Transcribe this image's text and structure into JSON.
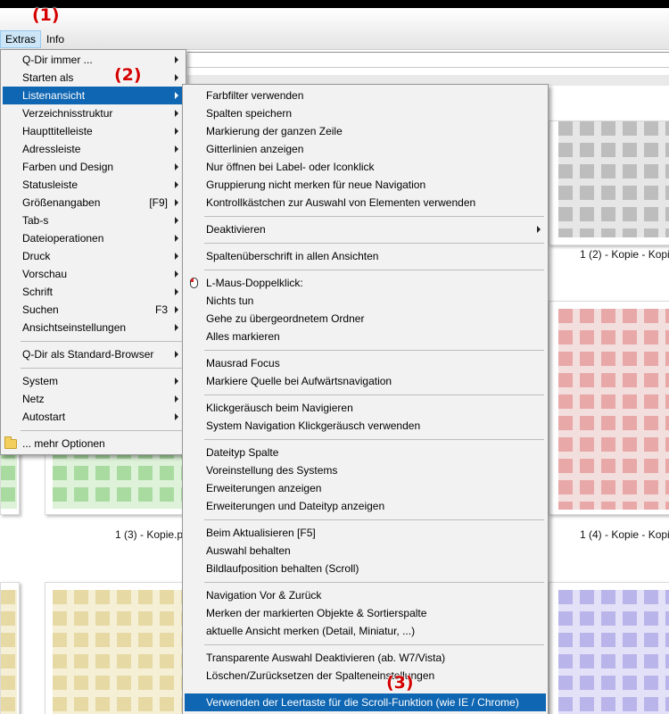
{
  "menubar": {
    "items": [
      "Extras",
      "Info"
    ]
  },
  "annotations": [
    "(1)",
    "(2)",
    "(3)"
  ],
  "file_labels": [
    "1 (2) - Kopie - Kopi",
    "1 (3) - Kopie.p",
    "1 (4) - Kopie - Kopi"
  ],
  "extras_menu": {
    "items": [
      {
        "label": "Q-Dir immer ...",
        "submenu": true
      },
      {
        "label": "Starten als",
        "submenu": true
      },
      {
        "label": "Listenansicht",
        "submenu": true,
        "selected": true
      },
      {
        "label": "Verzeichnisstruktur",
        "submenu": true
      },
      {
        "label": "Haupttitelleiste",
        "submenu": true
      },
      {
        "label": "Adressleiste",
        "submenu": true
      },
      {
        "label": "Farben und Design",
        "submenu": true
      },
      {
        "label": "Statusleiste",
        "submenu": true
      },
      {
        "label": "Größenangaben",
        "shortcut": "[F9]",
        "submenu": true
      },
      {
        "label": "Tab-s",
        "submenu": true
      },
      {
        "label": "Dateioperationen",
        "submenu": true
      },
      {
        "label": "Druck",
        "submenu": true
      },
      {
        "label": "Vorschau",
        "submenu": true
      },
      {
        "label": "Schrift",
        "submenu": true
      },
      {
        "label": "Suchen",
        "shortcut": "F3",
        "submenu": true
      },
      {
        "label": "Ansichtseinstellungen",
        "submenu": true
      },
      {
        "label": "Q-Dir als Standard-Browser",
        "submenu": true
      },
      {
        "label": "System",
        "submenu": true
      },
      {
        "label": "Netz",
        "submenu": true
      },
      {
        "label": "Autostart",
        "submenu": true
      },
      {
        "label": "... mehr Optionen",
        "icon": "folder-icon"
      }
    ]
  },
  "listenansicht_menu": {
    "items": [
      {
        "label": "Farbfilter verwenden"
      },
      {
        "label": "Spalten speichern"
      },
      {
        "label": "Markierung der ganzen Zeile"
      },
      {
        "label": "Gitterlinien anzeigen"
      },
      {
        "label": "Nur öffnen bei Label- oder Iconklick"
      },
      {
        "label": "Gruppierung nicht merken für neue Navigation"
      },
      {
        "label": "Kontrollkästchen zur Auswahl von Elementen verwenden"
      },
      {
        "label": "Deaktivieren",
        "submenu": true
      },
      {
        "label": "Spaltenüberschrift in allen Ansichten"
      },
      {
        "label": "L-Maus-Doppelklick:",
        "icon": "mouse-icon"
      },
      {
        "label": "Nichts tun"
      },
      {
        "label": "Gehe zu übergeordnetem Ordner"
      },
      {
        "label": "Alles markieren"
      },
      {
        "label": "Mausrad Focus"
      },
      {
        "label": "Markiere Quelle bei Aufwärtsnavigation"
      },
      {
        "label": "Klickgeräusch beim Navigieren"
      },
      {
        "label": "System Navigation Klickgeräusch verwenden"
      },
      {
        "label": "Dateityp Spalte"
      },
      {
        "label": "Voreinstellung des Systems"
      },
      {
        "label": "Erweiterungen anzeigen"
      },
      {
        "label": "Erweiterungen und Dateityp anzeigen"
      },
      {
        "label": "Beim Aktualisieren [F5]"
      },
      {
        "label": "Auswahl behalten"
      },
      {
        "label": "Bildlaufposition behalten (Scroll)"
      },
      {
        "label": "Navigation Vor & Zurück"
      },
      {
        "label": "Merken der markierten Objekte & Sortierspalte"
      },
      {
        "label": "aktuelle Ansicht merken (Detail, Miniatur, ...)"
      },
      {
        "label": "Transparente Auswahl Deaktivieren (ab. W7/Vista)"
      },
      {
        "label": "Löschen/Zurücksetzen der Spalteneinstellungen"
      },
      {
        "label": "Verwenden der Leertaste für die Scroll-Funktion (wie IE / Chrome)",
        "selected": true
      }
    ]
  },
  "colors": {
    "selection": "#0f66b2",
    "annotation": "#d40000"
  }
}
